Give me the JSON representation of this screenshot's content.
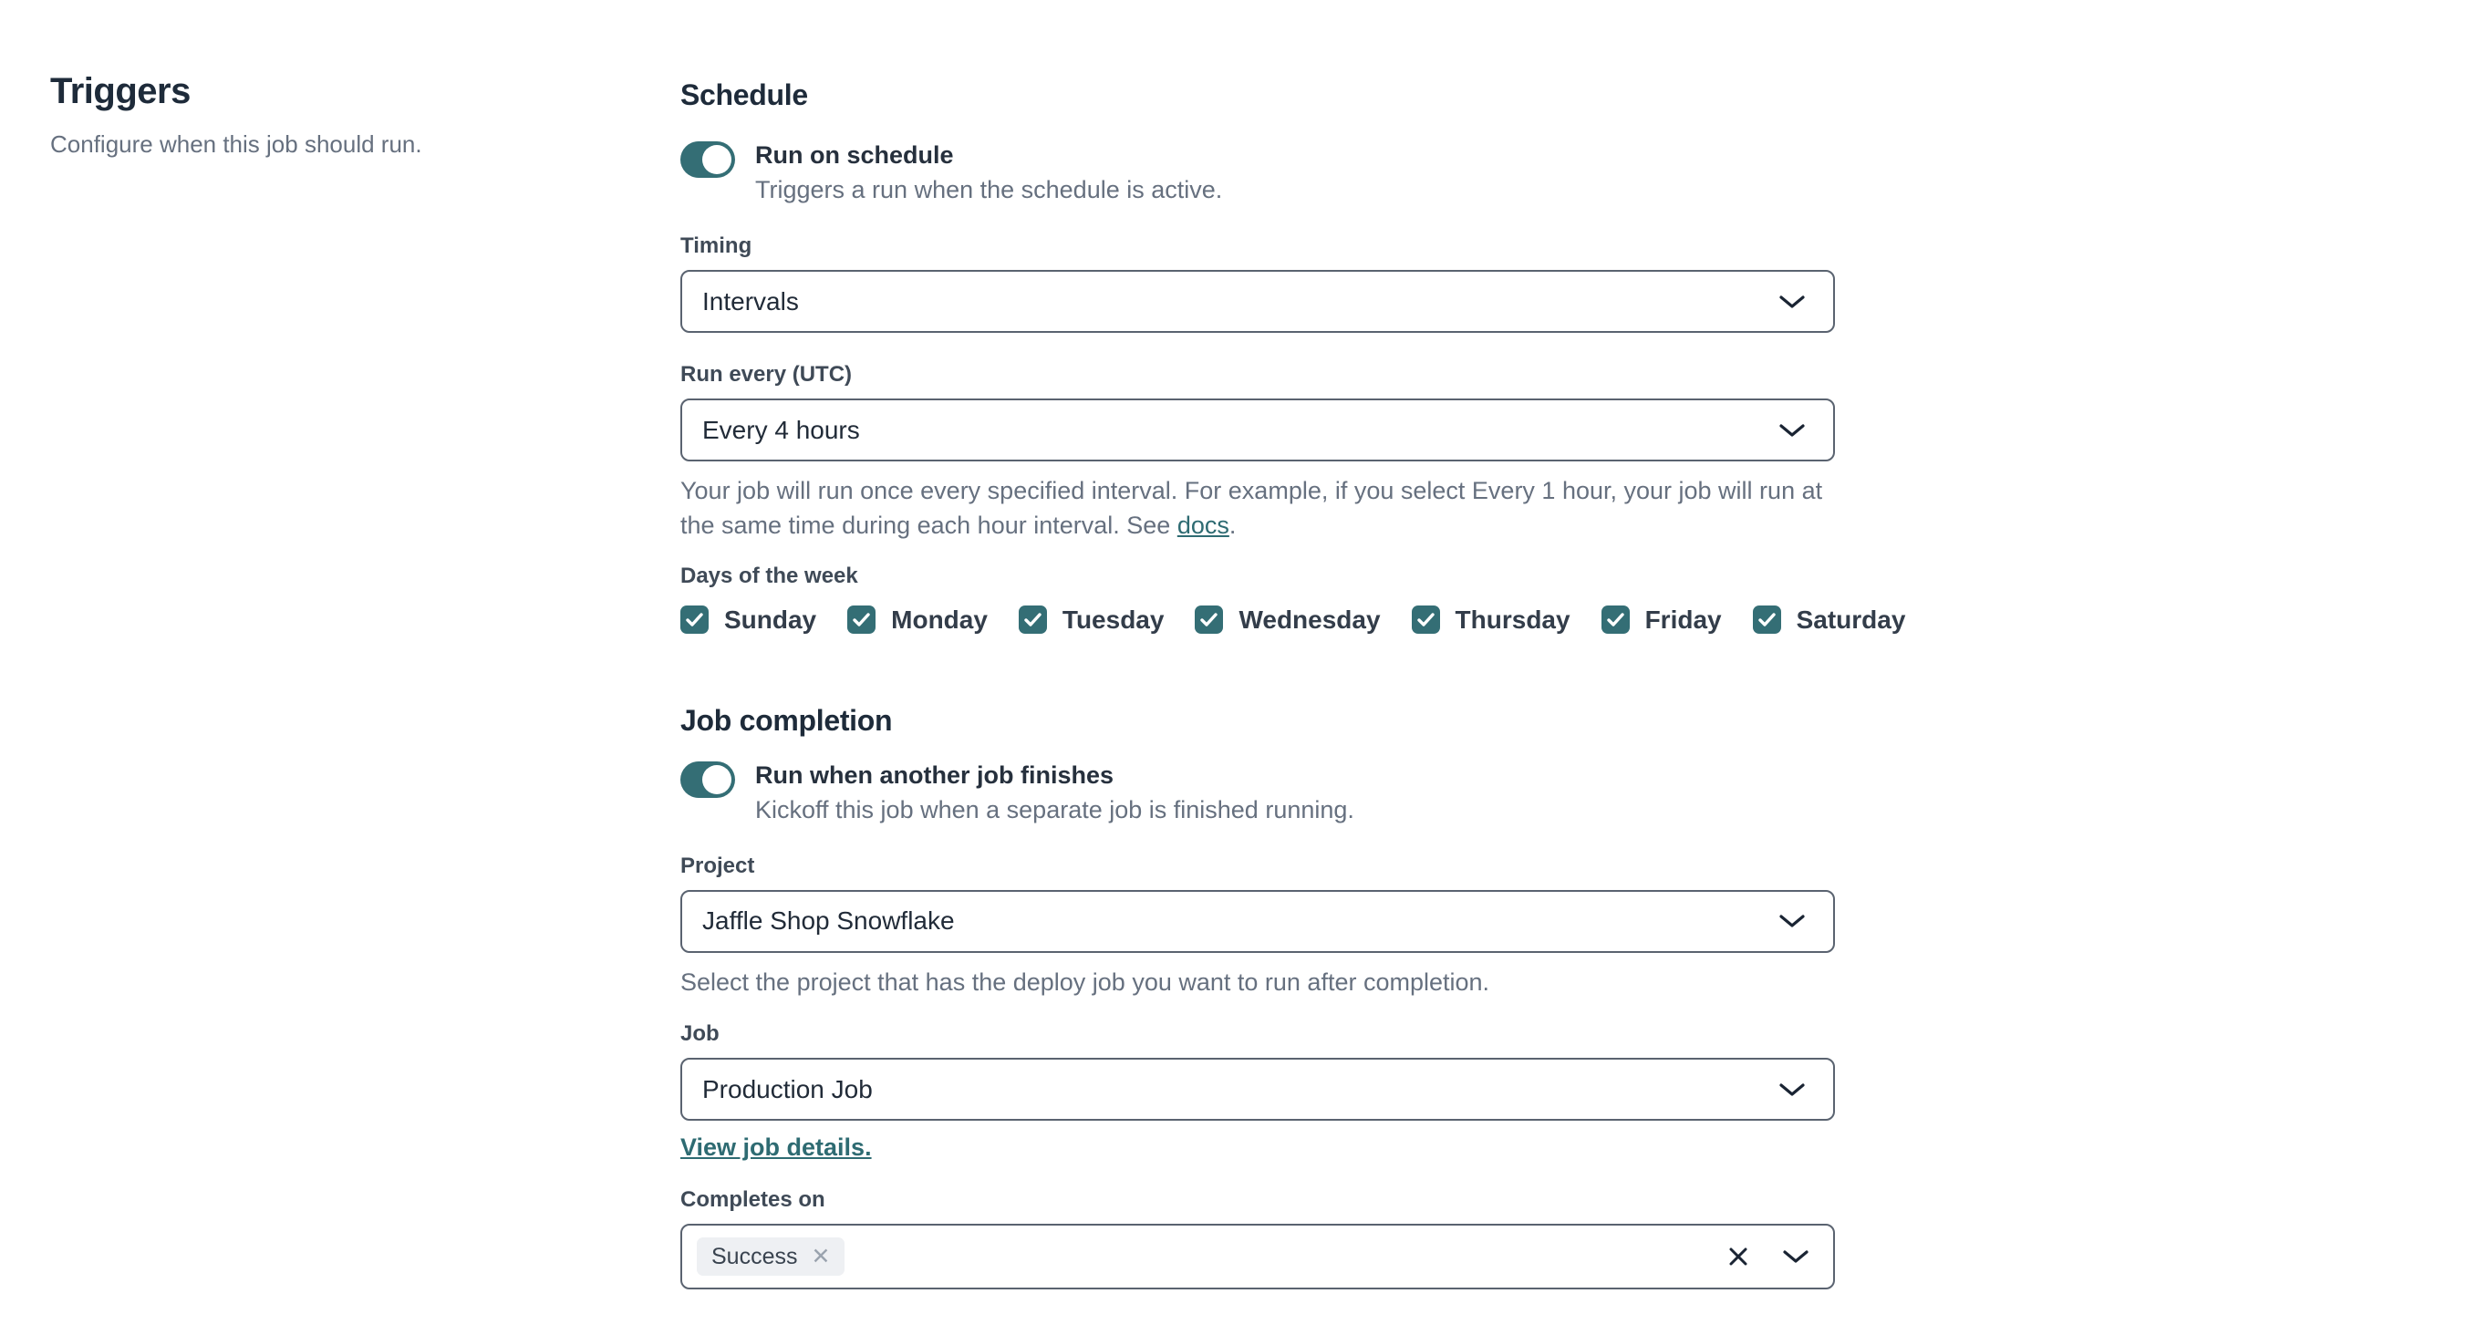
{
  "colors": {
    "accent_teal": "#346E75",
    "link_teal": "#2E6B72",
    "heading_text": "#1E2B3A",
    "muted_text": "#66707F",
    "input_border": "#5A6370",
    "tag_background": "#EEF0F3"
  },
  "intro": {
    "title": "Triggers",
    "description": "Configure when this job should run."
  },
  "schedule": {
    "heading": "Schedule",
    "run_on_schedule": {
      "label": "Run on schedule",
      "description": "Triggers a run when the schedule is active.",
      "state": "on"
    },
    "timing": {
      "label": "Timing",
      "value": "Intervals"
    },
    "run_every": {
      "label": "Run every (UTC)",
      "value": "Every 4 hours",
      "help_prefix": "Your job will run once every specified interval. For example, if you select Every 1 hour, your job will run at the same time during each hour interval. See ",
      "help_link_label": "docs",
      "help_suffix": "."
    },
    "days_of_week": {
      "label": "Days of the week",
      "items": [
        {
          "label": "Sunday",
          "checked": true
        },
        {
          "label": "Monday",
          "checked": true
        },
        {
          "label": "Tuesday",
          "checked": true
        },
        {
          "label": "Wednesday",
          "checked": true
        },
        {
          "label": "Thursday",
          "checked": true
        },
        {
          "label": "Friday",
          "checked": true
        },
        {
          "label": "Saturday",
          "checked": true
        }
      ]
    }
  },
  "job_completion": {
    "heading": "Job completion",
    "run_when_another": {
      "label": "Run when another job finishes",
      "description": "Kickoff this job when a separate job is finished running.",
      "state": "on"
    },
    "project": {
      "label": "Project",
      "value": "Jaffle Shop Snowflake",
      "help": "Select the project that has the deploy job you want to run after completion."
    },
    "job": {
      "label": "Job",
      "value": "Production Job",
      "link_label": "View job details."
    },
    "completes_on": {
      "label": "Completes on",
      "selected_tags": [
        {
          "label": "Success"
        }
      ]
    }
  }
}
